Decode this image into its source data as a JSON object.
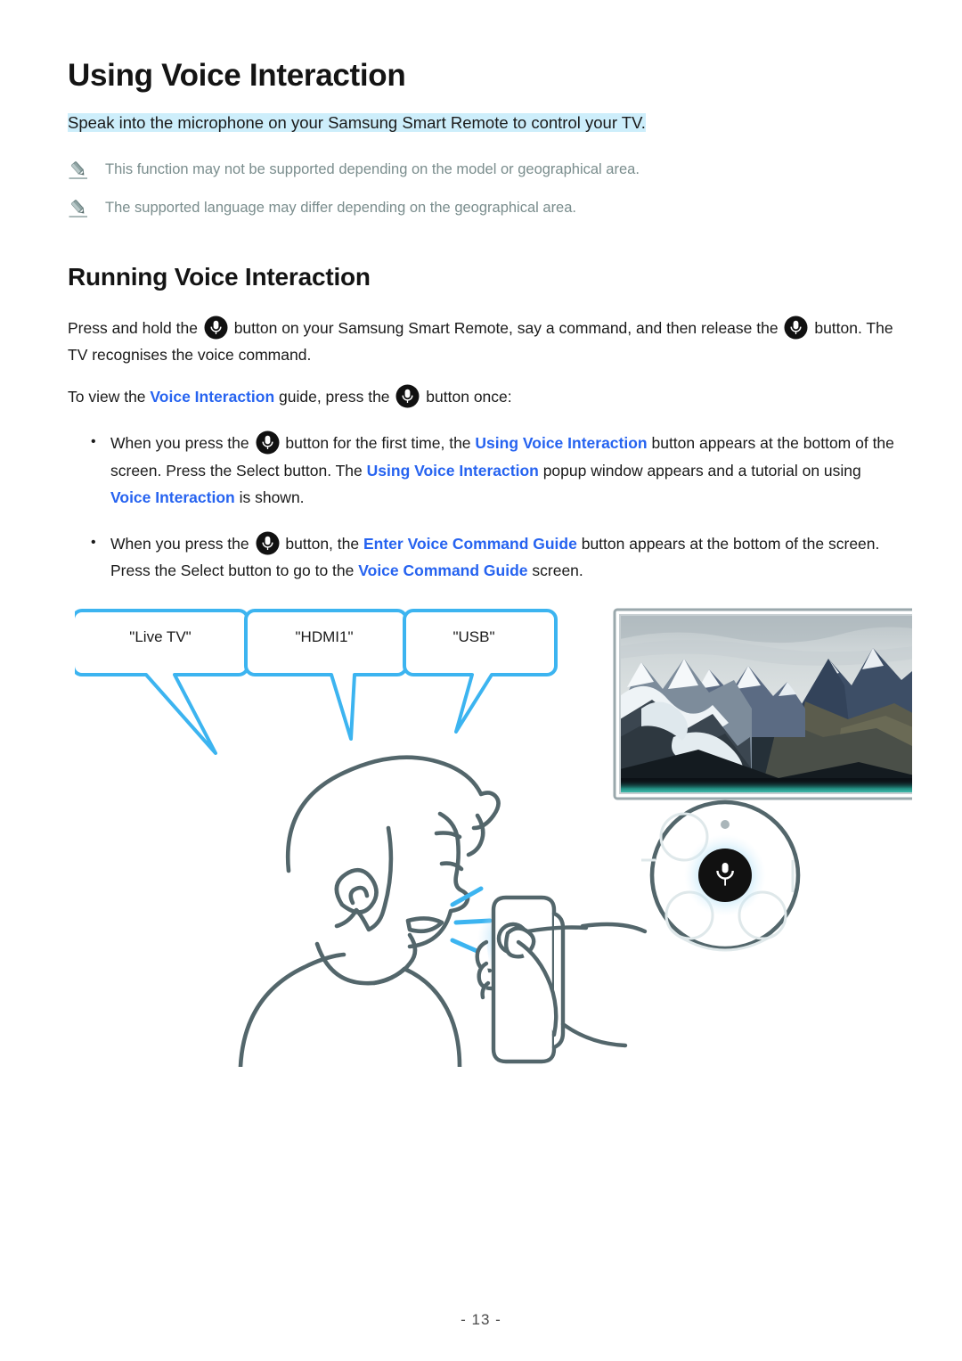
{
  "document": {
    "title": "Using Voice Interaction",
    "subtitle": "Speak into the microphone on your Samsung Smart Remote to control your TV.",
    "page_number": "- 13 -",
    "link_color": "#2663f0",
    "highlight_color": "#cdeefb",
    "accent_color": "#3cb4f0",
    "line_art_color": "#53666b"
  },
  "notes": [
    {
      "icon": "pencil-icon",
      "text": "This function may not be supported depending on the model or geographical area."
    },
    {
      "icon": "pencil-icon",
      "text": "The supported language may differ depending on the geographical area."
    }
  ],
  "section": {
    "heading": "Running Voice Interaction",
    "paragraph_1": {
      "part_1": "Press and hold the",
      "icon_1": "microphone-button-icon",
      "part_2": "button on your Samsung Smart Remote, say a command, and then release the",
      "icon_2": "microphone-button-icon",
      "part_3": "button. The TV recognises the voice command."
    },
    "paragraph_2": {
      "part_1": "To view the",
      "link_1": "Voice Interaction",
      "part_2": "guide, press the",
      "icon_1": "microphone-button-icon",
      "part_3": "button once:"
    }
  },
  "bullets": [
    {
      "marker": "•",
      "part_1": "When you press the",
      "icon_1": "microphone-button-icon",
      "part_2": "button for the first time, the",
      "link_1": "Using Voice Interaction",
      "part_3": "button appears at the bottom of the screen. Press the Select button. The",
      "link_2": "Using Voice Interaction",
      "part_4": "popup window appears and a tutorial on using",
      "link_3": "Voice Interaction",
      "part_5": "is shown."
    },
    {
      "marker": "•",
      "part_1": "When you press the",
      "icon_1": "microphone-button-icon",
      "part_2": "button, the",
      "link_1": "Enter Voice Command Guide",
      "part_3": "button appears at the bottom of the screen. Press the Select button to go to the",
      "link_2": "Voice Command Guide",
      "part_4": "screen."
    }
  ],
  "illustration": {
    "alt": "Person speaking voice commands into a Samsung Smart Remote while a TV displays a mountain glacier scene",
    "speech_bubbles": [
      {
        "label": "\"Live TV\""
      },
      {
        "label": "\"HDMI1\""
      },
      {
        "label": "\"USB\""
      }
    ],
    "tv_screen": "mountain-glacier-photo",
    "remote_closeup": "remote-microphone-button-closeup",
    "person": "person-profile-line-art"
  }
}
